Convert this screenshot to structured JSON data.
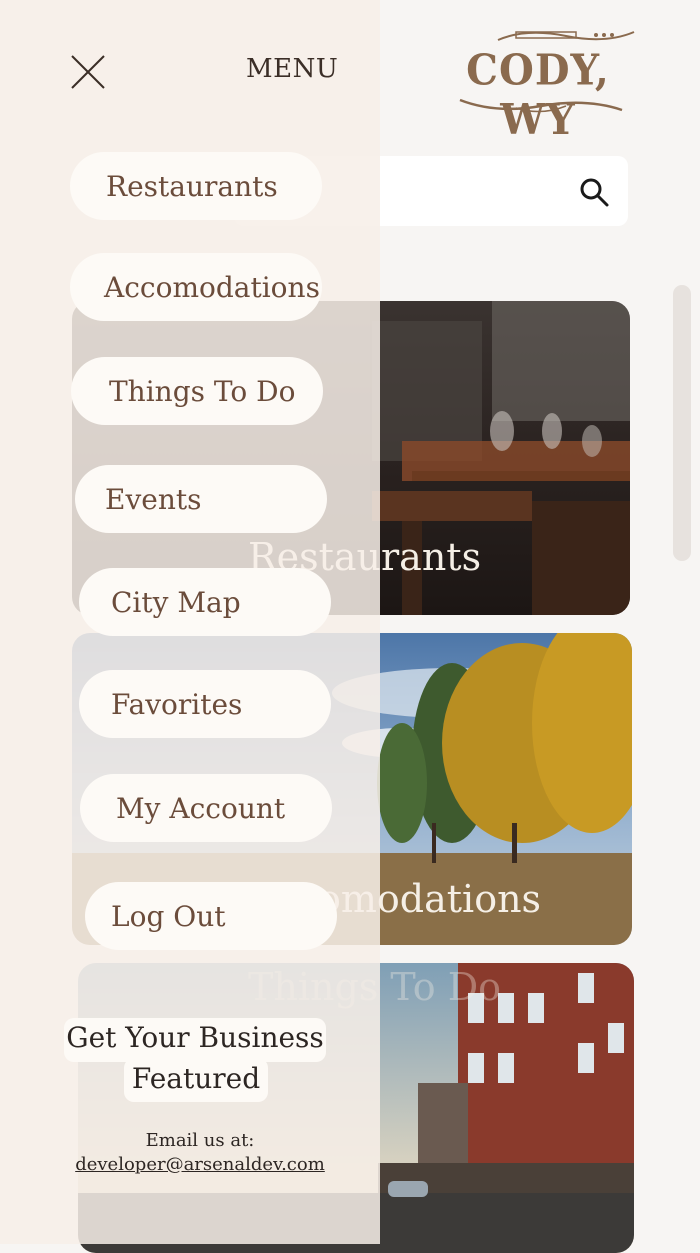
{
  "app": {
    "logo_text": "CODY, WY"
  },
  "search": {
    "icon": "search-icon"
  },
  "cards": [
    {
      "label": "Restaurants"
    },
    {
      "label": "Accomodations"
    },
    {
      "label": "Things To Do"
    }
  ],
  "menu": {
    "title": "MENU",
    "close_icon": "close-icon",
    "items": [
      {
        "label": "Restaurants"
      },
      {
        "label": "Accomodations"
      },
      {
        "label": "Things To Do"
      },
      {
        "label": "Events"
      },
      {
        "label": "City Map"
      },
      {
        "label": "Favorites"
      },
      {
        "label": "My Account"
      },
      {
        "label": "Log Out"
      }
    ],
    "feature": {
      "line1": "Get Your Business",
      "line2": "Featured",
      "email_label": "Email us at:",
      "email": "developer@arsenaldev.com"
    }
  },
  "colors": {
    "menu_bg": "#f7efe8",
    "pill_bg": "#fdfaf6",
    "menu_text": "#6b4c3b",
    "logo": "#8a6a4e"
  }
}
